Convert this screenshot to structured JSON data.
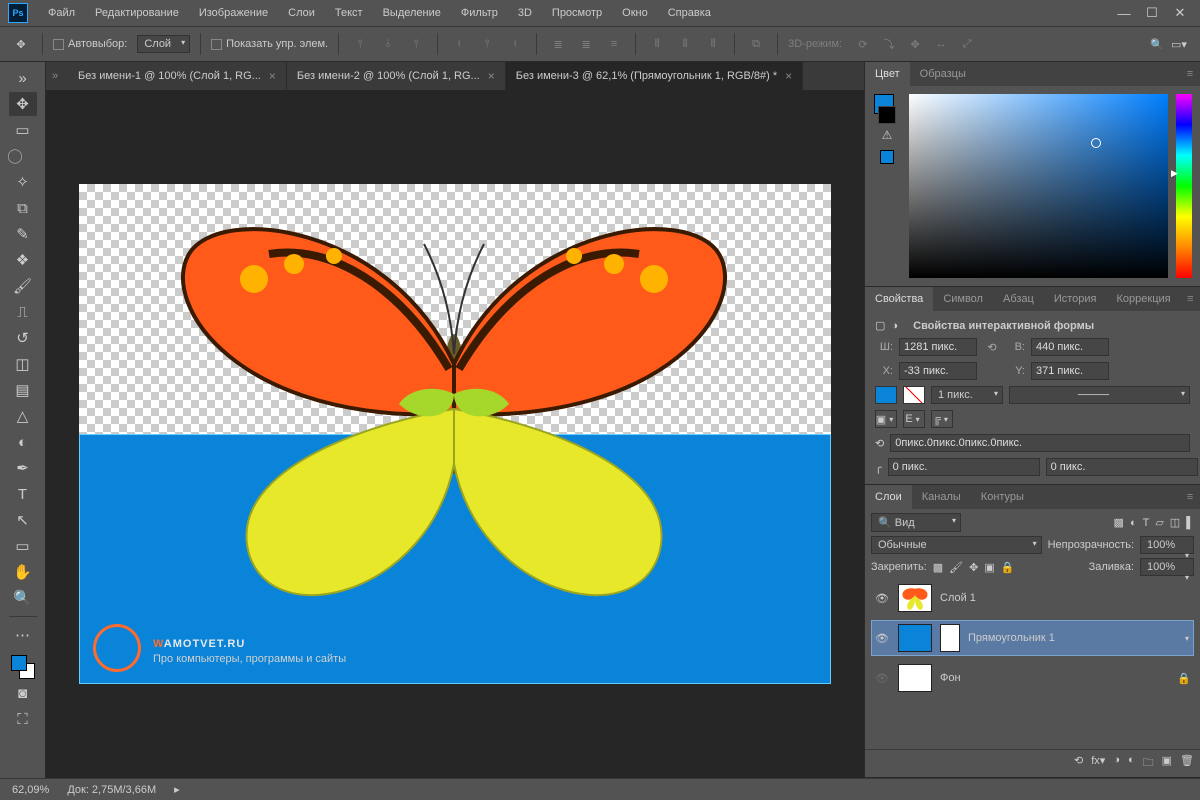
{
  "menu": [
    "Файл",
    "Редактирование",
    "Изображение",
    "Слои",
    "Текст",
    "Выделение",
    "Фильтр",
    "3D",
    "Просмотр",
    "Окно",
    "Справка"
  ],
  "options": {
    "auto_select": "Автовыбор:",
    "layer_dropdown": "Слой",
    "show_transform": "Показать упр. элем.",
    "mode3d": "3D-режим:"
  },
  "tabs": [
    {
      "label": "Без имени-1 @ 100% (Слой 1, RG...",
      "active": false
    },
    {
      "label": "Без имени-2 @ 100% (Слой 1, RG...",
      "active": false
    },
    {
      "label": "Без имени-3 @ 62,1% (Прямоугольник 1, RGB/8#) *",
      "active": true
    }
  ],
  "watermark": {
    "brand_orange": "W",
    "brand_white": "AMOTVET.RU",
    "sub": "Про компьютеры, программы и сайты"
  },
  "panels": {
    "color": {
      "tabs": [
        "Цвет",
        "Образцы"
      ]
    },
    "props": {
      "tabs": [
        "Свойства",
        "Символ",
        "Абзац",
        "История",
        "Коррекция"
      ],
      "title": "Свойства интерактивной формы",
      "w_lbl": "Ш:",
      "w": "1281 пикс.",
      "h_lbl": "В:",
      "h": "440 пикс.",
      "x_lbl": "X:",
      "x": "-33 пикс.",
      "y_lbl": "Y:",
      "y": "371 пикс.",
      "stroke": "1 пикс.",
      "corners_all": "0пикс.0пикс.0пикс.0пикс.",
      "corner": "0 пикс."
    },
    "layers": {
      "tabs": [
        "Слои",
        "Каналы",
        "Контуры"
      ],
      "filter": "Вид",
      "blend": "Обычные",
      "opacity_lbl": "Непрозрачность:",
      "opacity": "100%",
      "lock_lbl": "Закрепить:",
      "fill_lbl": "Заливка:",
      "fill": "100%",
      "items": [
        {
          "name": "Слой 1"
        },
        {
          "name": "Прямоугольник 1"
        },
        {
          "name": "Фон"
        }
      ]
    }
  },
  "status": {
    "zoom": "62,09%",
    "doc": "Док: 2,75M/3,66M"
  },
  "colors": {
    "accent": "#0a84d8"
  }
}
